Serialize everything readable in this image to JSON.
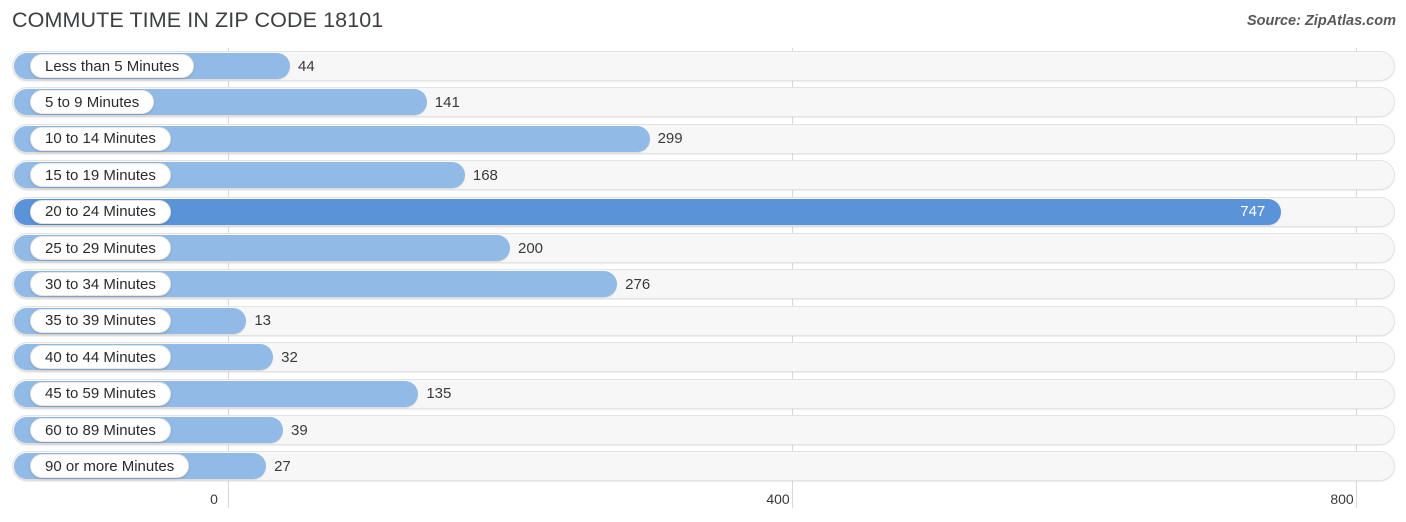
{
  "header": {
    "title": "COMMUTE TIME IN ZIP CODE 18101",
    "source": "Source: ZipAtlas.com"
  },
  "colors": {
    "bar": "#92bae6",
    "bar_highlight": "#5b93d8",
    "track": "#f7f7f7",
    "gridline": "#d8d8d8",
    "text": "#3a3a3a",
    "title": "#3c4043"
  },
  "chart_data": {
    "type": "bar",
    "orientation": "horizontal",
    "title": "COMMUTE TIME IN ZIP CODE 18101",
    "xlabel": "",
    "ylabel": "",
    "xlim": [
      0,
      800
    ],
    "xticks": [
      0,
      400,
      800
    ],
    "xtick_labels": [
      "0",
      "400",
      "800"
    ],
    "grid": true,
    "legend": false,
    "highlight_index": 4,
    "categories": [
      "Less than 5 Minutes",
      "5 to 9 Minutes",
      "10 to 14 Minutes",
      "15 to 19 Minutes",
      "20 to 24 Minutes",
      "25 to 29 Minutes",
      "30 to 34 Minutes",
      "35 to 39 Minutes",
      "40 to 44 Minutes",
      "45 to 59 Minutes",
      "60 to 89 Minutes",
      "90 or more Minutes"
    ],
    "values": [
      44,
      141,
      299,
      168,
      747,
      200,
      276,
      13,
      32,
      135,
      39,
      27
    ],
    "value_labels": [
      "44",
      "141",
      "299",
      "168",
      "747",
      "200",
      "276",
      "13",
      "32",
      "135",
      "39",
      "27"
    ]
  },
  "axis": {
    "ticks": [
      {
        "label": "0",
        "value": 0
      },
      {
        "label": "400",
        "value": 400
      },
      {
        "label": "800",
        "value": 800
      }
    ]
  }
}
